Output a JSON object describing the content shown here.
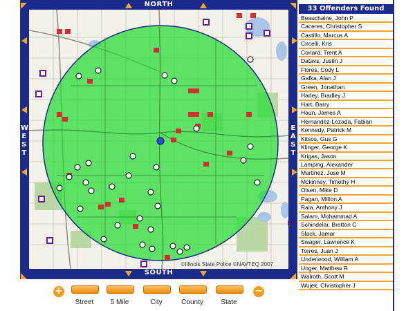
{
  "map": {
    "north_label": "NORTH",
    "south_label": "SOUTH",
    "west_label": "W\nE\nS\nT",
    "east_label": "E\nA\nS\nT",
    "copyright": "©Illinois State Police ©NAVTEQ 2007",
    "search_radius_color": "#22dd33",
    "border_color": "#1c2a8c",
    "accent_color": "#f5a623"
  },
  "offenders": {
    "header": "33 Offenders Found",
    "names": [
      "Beauchaine, John P",
      "Caceres, Christopher S",
      "Castillo, Marcus A",
      "Circelli, Kris",
      "Conard, Trent A",
      "Datavs, Justin J",
      "Flores, Cody L",
      "Gafka, Alan J",
      "Green, Jonathan",
      "Harley, Bradley J",
      "Hart, Barry",
      "Haun, James A",
      "Hernandez-Lozada, Fabian",
      "Kennedy, Patrick M",
      "Kitsos, Gus G",
      "Klinger, George K",
      "Krigas, Jason",
      "Lamping, Alexander",
      "Martinez, Jose M",
      "Mckinney, Timothy H",
      "Olsen, Mike D",
      "Pagan, Milton A",
      "Raia, Anthony J",
      "Salam, Mohammad A",
      "Schindelar, Bretton C",
      "Slack, Jamar",
      "Swager, Lawrence K",
      "Torres, Juan J",
      "Underwood, William A",
      "Unger, Matthew R",
      "Walroth, Scott M",
      "Wujek, Christopher J"
    ]
  },
  "zoom": {
    "zoom_in_symbol": "+",
    "zoom_out_symbol": "−",
    "levels": [
      "Street",
      "5 Mile",
      "City",
      "County",
      "State"
    ]
  }
}
